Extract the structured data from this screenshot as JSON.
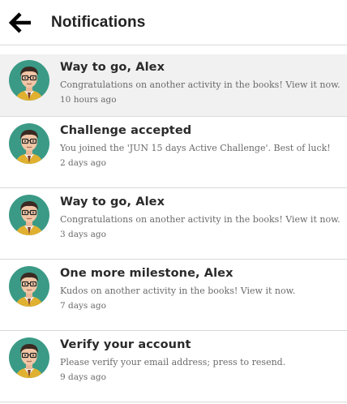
{
  "header": {
    "back_icon": "arrow-left-icon",
    "title": "Notifications"
  },
  "notifications": [
    {
      "title": "Way to go, Alex",
      "body": "Congratulations on another activity in the books! View it now.",
      "time": "10 hours ago",
      "highlighted": true
    },
    {
      "title": "Challenge accepted",
      "body": "You joined the 'JUN 15 days Active Challenge'. Best of luck!",
      "time": "2 days ago",
      "highlighted": false
    },
    {
      "title": "Way to go, Alex",
      "body": "Congratulations on another activity in the books! View it now.",
      "time": "3 days ago",
      "highlighted": false
    },
    {
      "title": "One more milestone, Alex",
      "body": "Kudos on another activity in the books! View it now.",
      "time": "7 days ago",
      "highlighted": false
    },
    {
      "title": "Verify your account",
      "body": "Please verify your email address; press to resend.",
      "time": "9 days ago",
      "highlighted": false
    }
  ],
  "colors": {
    "highlight_bg": "#f1f1f1",
    "avatar_bg": "#3a9a86",
    "divider": "#d9d9d9"
  }
}
